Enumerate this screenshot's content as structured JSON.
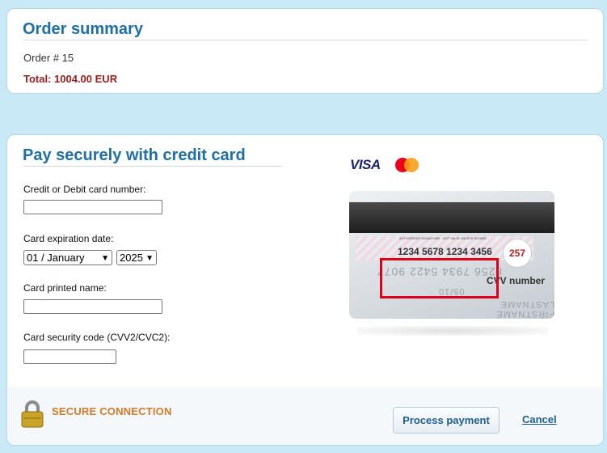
{
  "summary": {
    "title": "Order summary",
    "order_number": "Order # 15",
    "total": "Total: 1004.00 EUR"
  },
  "payment": {
    "title": "Pay securely with credit card",
    "card_number_label": "Credit or Debit card number:",
    "card_number_value": "",
    "expiration_label": "Card expiration date:",
    "expiration_month": "01 / January",
    "expiration_year": "2025",
    "printed_name_label": "Card printed name:",
    "printed_name_value": "",
    "security_code_label": "Card security code (CVV2/CVC2):",
    "security_code_value": ""
  },
  "brands": {
    "visa": "VISA",
    "mastercard": "mastercard-logo"
  },
  "card_illustration": {
    "authorized": "AUTHORIZED SIGNATURE - NOT VALID UNLESS SIGNED",
    "number": "1234 5678 1234 3456",
    "cvv": "257",
    "cvv_label": "CVV number",
    "embossed_number": "8256 7934 5422 9077",
    "embossed_date": "05/10",
    "embossed_name": "FIRSTNAME LASTNAME"
  },
  "footer": {
    "secure_label": "SECURE CONNECTION",
    "process_label": "Process payment",
    "cancel_label": "Cancel"
  },
  "colors": {
    "accent": "#1e6fa6",
    "total": "#9c1c1c",
    "secure": "#d07a2a",
    "highlight": "#e0001a"
  }
}
